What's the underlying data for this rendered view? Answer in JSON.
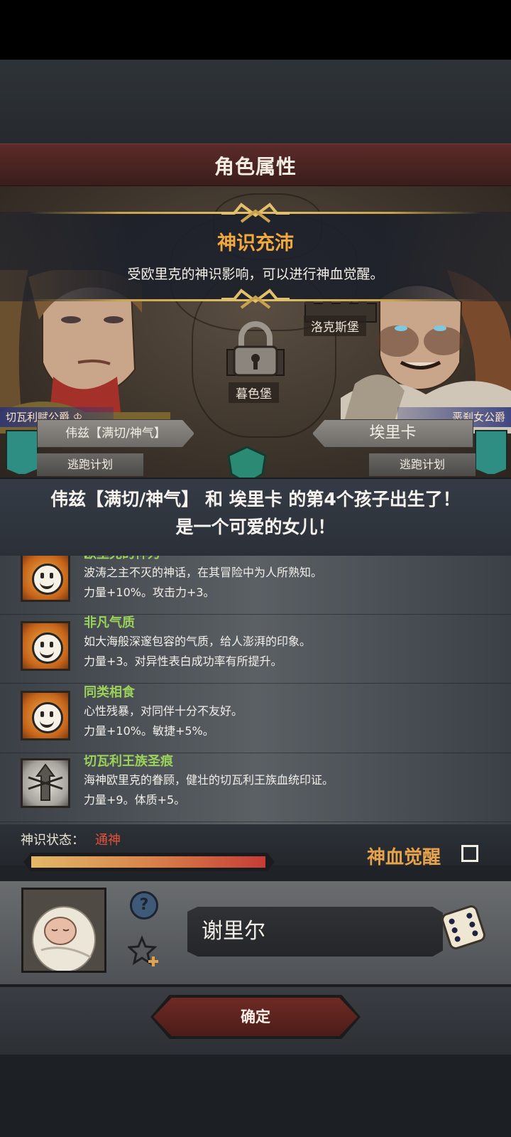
{
  "screen": {
    "title": "角色属性"
  },
  "banner": {
    "title": "神识充沛",
    "description": "受欧里克的神识影响，可以进行神血觉醒。"
  },
  "map": {
    "locations": [
      "洛克斯堡",
      "暮色堡"
    ]
  },
  "left_character": {
    "rank": "切瓦利赋公爵",
    "name": "伟兹【满切/神气】",
    "status": "逃跑计划"
  },
  "right_character": {
    "rank": "恶刹女公爵",
    "name": "埃里卡",
    "status": "逃跑计划"
  },
  "announcement": {
    "line1": "伟兹【满切/神气】 和 埃里卡 的第4个孩子出生了！",
    "line2": "是一个可爱的女儿！"
  },
  "traits": [
    {
      "icon": "smile-icon",
      "name": "欧里克的神力",
      "description": "波涛之主不灭的神话，在其冒险中为人所熟知。",
      "stats": "力量+10%。攻击力+3。"
    },
    {
      "icon": "smile-icon",
      "name": "非凡气质",
      "description": "如大海般深邃包容的气质，给人澎湃的印象。",
      "stats": "力量+3。对异性表白成功率有所提升。"
    },
    {
      "icon": "smile-icon",
      "name": "同类相食",
      "description": "心性残暴，对同伴十分不友好。",
      "stats": "力量+10%。敏捷+5%。"
    },
    {
      "icon": "royal-crest-icon",
      "name": "切瓦利王族圣痕",
      "description": "海神欧里克的眷顾，健壮的切瓦利王族血统印证。",
      "stats": "力量+9。体质+5。"
    }
  ],
  "divine_state": {
    "label": "神识状态：",
    "value": "通神",
    "fill": 1.0
  },
  "awakening": {
    "label": "神血觉醒",
    "checked": false
  },
  "child": {
    "name": "谢里尔"
  },
  "confirm_label": "确定",
  "colors": {
    "accent_orange": "#f0a93e",
    "trait_green": "#9ad25a",
    "status_red": "#e4533a",
    "title_bar": "#5b2b28"
  }
}
